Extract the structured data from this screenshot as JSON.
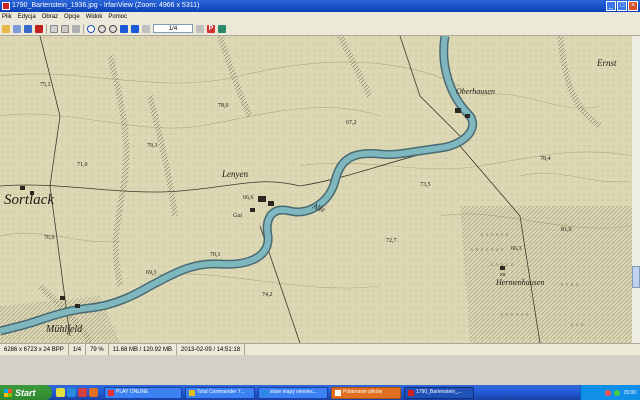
{
  "window": {
    "title": "1790_Bartenstein_1936.jpg - IrfanView (Zoom: 4966 x 5311)",
    "buttons": [
      "_",
      "□",
      "×"
    ]
  },
  "menu": {
    "items": [
      "Plik",
      "Edycja",
      "Obraz",
      "Opcje",
      "Widok",
      "Pomoc"
    ]
  },
  "toolbar": {
    "page": "1/4"
  },
  "map": {
    "labels": {
      "sortlack": "Sortlack",
      "lenyen": "Lenyen",
      "muhlfeld": "Mühlfeld",
      "uberhausen": "Oberhausen",
      "ernst": "Ernst",
      "hermenhausen": "Hermenhausen",
      "gut": "Gut",
      "alle": "Alle",
      "zu": "zu",
      "e78": "78,0",
      "e79": "79,3",
      "e71": "71,0",
      "e66": "66,6",
      "e76": "76,9",
      "e72": "72,7",
      "e69": "69,3",
      "e67": "67,2",
      "e81": "81,0",
      "e78b": "78,4",
      "e66b": "66,3",
      "e74": "74,2",
      "e70": "70,1",
      "e73": "73,5",
      "e75": "75,1"
    }
  },
  "status": {
    "dims": "6286 x 6723 x 24 BPP",
    "page": "1/4",
    "zoom": "79 %",
    "size": "11.68 MB / 120.92 MB",
    "datetime": "2013-02-09 / 14:51:18"
  },
  "taskbar": {
    "start": "Start",
    "tasks": [
      "PLAY ONLINE",
      "Total Commander 7...",
      "stare mapy niemiec...",
      "Pobieranie plików",
      "1790_Bartenstein_..."
    ],
    "clock": "15:00",
    "colors": {
      "start": "#3c9a3c",
      "taskbar": "#245edc",
      "tray": "#0f8fe8"
    }
  }
}
